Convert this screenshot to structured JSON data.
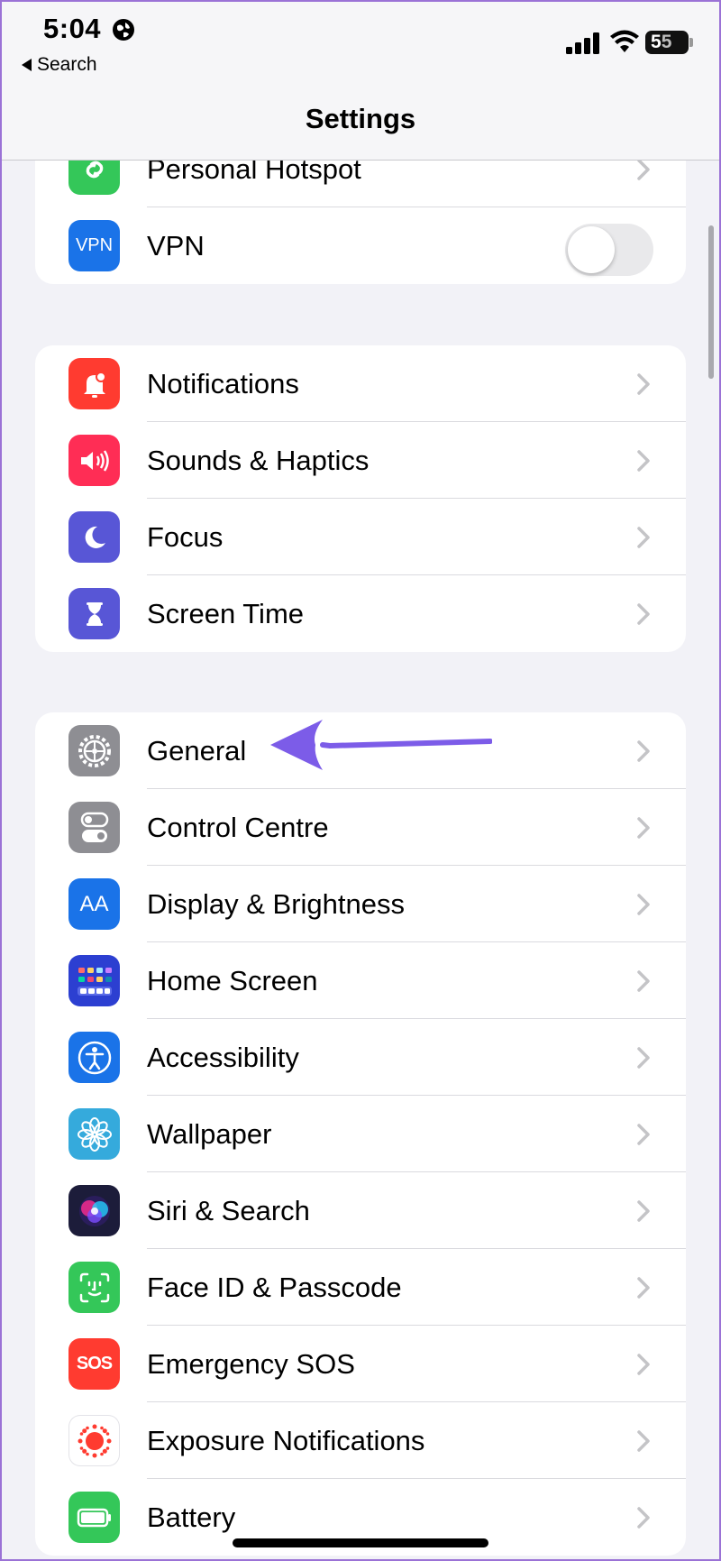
{
  "status_bar": {
    "time": "5:04",
    "back_label": "Search",
    "battery_first": "5",
    "battery_rest": "5"
  },
  "nav": {
    "title": "Settings"
  },
  "groups": [
    {
      "rows": [
        {
          "label": "Personal Hotspot",
          "icon": "hotspot-icon",
          "color": "#34c759"
        },
        {
          "label": "VPN",
          "icon": "vpn-icon",
          "icon_text": "VPN",
          "color": "#1a73e8",
          "toggle": false
        }
      ]
    },
    {
      "rows": [
        {
          "label": "Notifications",
          "icon": "bell-icon",
          "color": "#ff3b30"
        },
        {
          "label": "Sounds & Haptics",
          "icon": "speaker-icon",
          "color": "#ff2d55"
        },
        {
          "label": "Focus",
          "icon": "moon-icon",
          "color": "#5856d6"
        },
        {
          "label": "Screen Time",
          "icon": "hourglass-icon",
          "color": "#5856d6"
        }
      ]
    },
    {
      "rows": [
        {
          "label": "General",
          "icon": "gear-icon",
          "color": "#8e8e93"
        },
        {
          "label": "Control Centre",
          "icon": "switches-icon",
          "color": "#8e8e93"
        },
        {
          "label": "Display & Brightness",
          "icon": "text-size-icon",
          "icon_text": "AA",
          "color": "#1a73e8"
        },
        {
          "label": "Home Screen",
          "icon": "home-grid-icon",
          "color": "#2c3fd1"
        },
        {
          "label": "Accessibility",
          "icon": "accessibility-icon",
          "color": "#1a73e8"
        },
        {
          "label": "Wallpaper",
          "icon": "flower-icon",
          "color": "#35aadc"
        },
        {
          "label": "Siri & Search",
          "icon": "siri-icon",
          "color": "#1c1c3a"
        },
        {
          "label": "Face ID & Passcode",
          "icon": "face-id-icon",
          "color": "#34c759"
        },
        {
          "label": "Emergency SOS",
          "icon": "sos-icon",
          "icon_text": "SOS",
          "color": "#ff3b30"
        },
        {
          "label": "Exposure Notifications",
          "icon": "exposure-icon",
          "color": "#ffffff"
        },
        {
          "label": "Battery",
          "icon": "battery-icon",
          "color": "#34c759"
        }
      ]
    }
  ],
  "annotation": {
    "target": "General",
    "color": "#7c5ce8"
  }
}
